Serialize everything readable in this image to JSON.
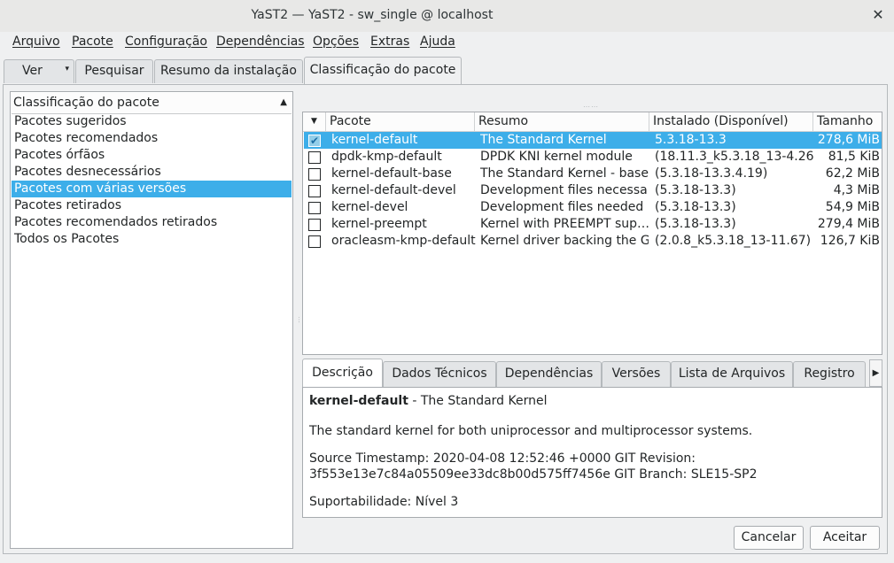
{
  "window": {
    "title": "YaST2 — YaST2 - sw_single @ localhost",
    "close": "✕"
  },
  "menu": [
    {
      "label": "Arquivo"
    },
    {
      "label": "Pacote"
    },
    {
      "label": "Configuração"
    },
    {
      "label": "Dependências"
    },
    {
      "label": "Opções"
    },
    {
      "label": "Extras"
    },
    {
      "label": "Ajuda"
    }
  ],
  "top_tabs": {
    "view_label": "Ver",
    "search_label": "Pesquisar",
    "summary_label": "Resumo da instalação",
    "classification_label": "Classificação do pacote"
  },
  "filter": {
    "header": "Classificação do pacote",
    "items": [
      {
        "label": "Pacotes sugeridos"
      },
      {
        "label": "Pacotes recomendados"
      },
      {
        "label": "Pacotes órfãos"
      },
      {
        "label": "Pacotes desnecessários"
      },
      {
        "label": "Pacotes com várias versões",
        "selected": true
      },
      {
        "label": "Pacotes retirados"
      },
      {
        "label": "Pacotes recomendados retirados"
      },
      {
        "label": "Todos os Pacotes"
      }
    ]
  },
  "packages": {
    "columns": {
      "package": "Pacote",
      "summary": "Resumo",
      "installed": "Instalado (Disponível)",
      "size": "Tamanho"
    },
    "rows": [
      {
        "checked": true,
        "name": "kernel-default",
        "summary": "The Standard Kernel",
        "installed": "5.3.18-13.3",
        "size": "278,6 MiB",
        "selected": true
      },
      {
        "checked": false,
        "name": "dpdk-kmp-default",
        "summary": "DPDK KNI kernel module",
        "installed": "(18.11.3_k5.3.18_13-4.26)",
        "size": "81,5 KiB"
      },
      {
        "checked": false,
        "name": "kernel-default-base",
        "summary": "The Standard Kernel - base…",
        "installed": "(5.3.18-13.3.4.19)",
        "size": "62,2 MiB"
      },
      {
        "checked": false,
        "name": "kernel-default-devel",
        "summary": "Development files necessa…",
        "installed": "(5.3.18-13.3)",
        "size": "4,3 MiB"
      },
      {
        "checked": false,
        "name": "kernel-devel",
        "summary": "Development files needed …",
        "installed": "(5.3.18-13.3)",
        "size": "54,9 MiB"
      },
      {
        "checked": false,
        "name": "kernel-preempt",
        "summary": "Kernel with PREEMPT sup…",
        "installed": "(5.3.18-13.3)",
        "size": "279,4 MiB"
      },
      {
        "checked": false,
        "name": "oracleasm-kmp-default",
        "summary": "Kernel driver backing the G…",
        "installed": "(2.0.8_k5.3.18_13-11.67)",
        "size": "126,7 KiB"
      }
    ]
  },
  "detail_tabs": {
    "description": "Descrição",
    "technical": "Dados Técnicos",
    "dependencies": "Dependências",
    "versions": "Versões",
    "files": "Lista de Arquivos",
    "log": "Registro"
  },
  "description": {
    "name": "kernel-default",
    "name_suffix": " - The Standard Kernel",
    "body": "The standard kernel for both uniprocessor and multiprocessor systems.",
    "timestamp_line1": "Source Timestamp: 2020-04-08 12:52:46 +0000 GIT Revision:",
    "timestamp_line2": "3f553e13e7c84a05509ee33dc8b00d575ff7456e GIT Branch: SLE15-SP2",
    "support": "Suportabilidade: Nível 3"
  },
  "buttons": {
    "cancel": "Cancelar",
    "accept": "Aceitar"
  }
}
